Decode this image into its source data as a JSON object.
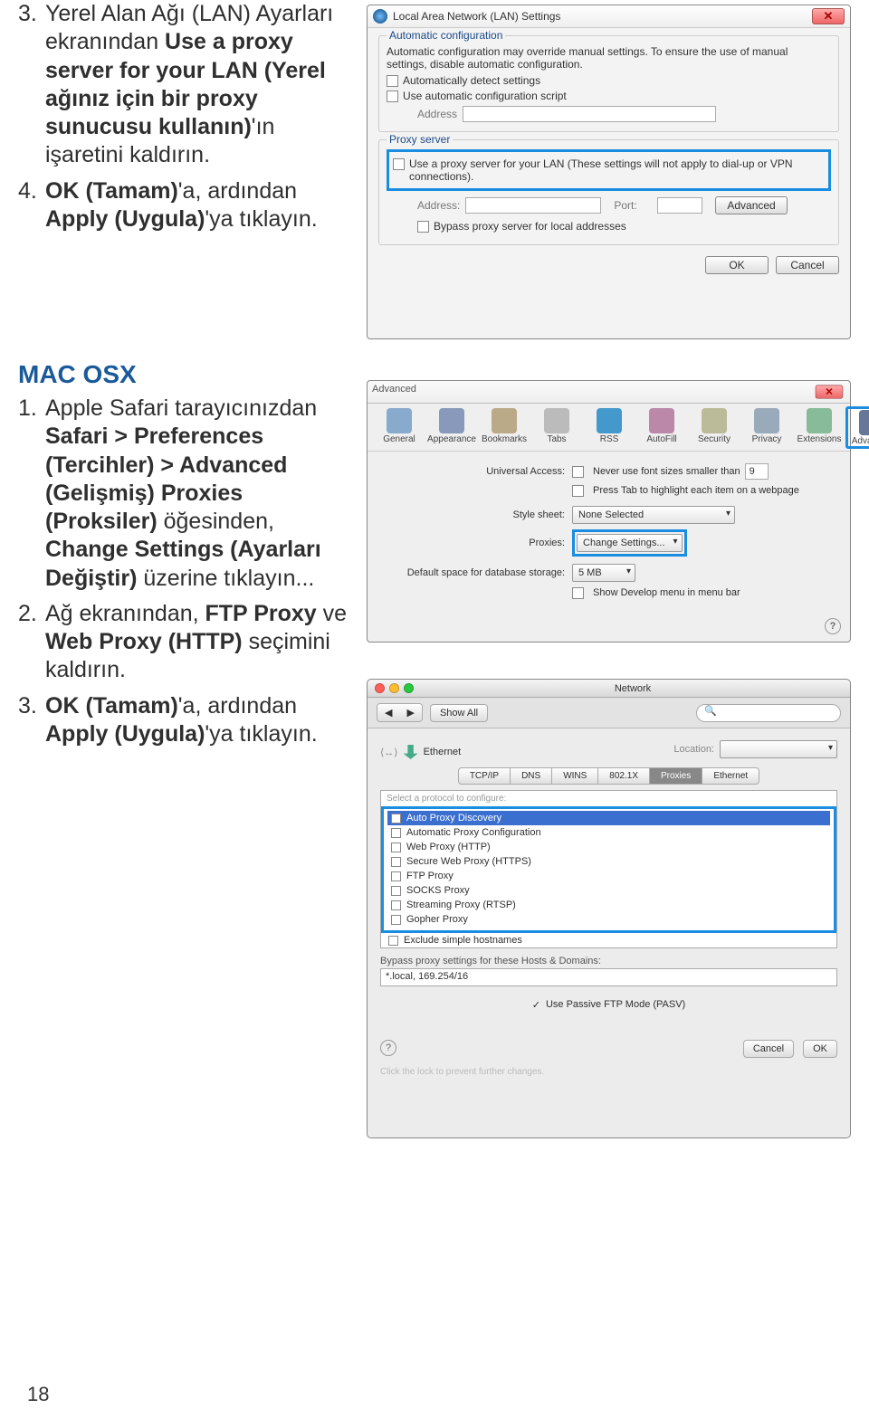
{
  "left": {
    "lan_steps": [
      {
        "num": "3.",
        "segments": [
          {
            "t": "Yerel Alan Ağı (LAN) Ayarları ekranından ",
            "b": false
          },
          {
            "t": "Use a proxy server for your LAN (Yerel ağınız için bir proxy sunucusu kullanın)",
            "b": true
          },
          {
            "t": "'ın işaretini kaldırın.",
            "b": false
          }
        ]
      },
      {
        "num": "4.",
        "segments": [
          {
            "t": "OK (Tamam)",
            "b": true
          },
          {
            "t": "'a, ardından ",
            "b": false
          },
          {
            "t": "Apply (Uygula)",
            "b": true
          },
          {
            "t": "'ya tıklayın.",
            "b": false
          }
        ]
      }
    ],
    "mac_heading": "MAC OSX",
    "mac_steps": [
      {
        "num": "1.",
        "segments": [
          {
            "t": "Apple Safari tarayıcınızdan ",
            "b": false
          },
          {
            "t": "Safari > Preferences (Tercihler) > Advanced (Gelişmiş) Proxies (Proksiler)",
            "b": true
          },
          {
            "t": " öğesinden, ",
            "b": false
          },
          {
            "t": "Change Settings (Ayarları Değiştir)",
            "b": true
          },
          {
            "t": " üzerine tıklayın...",
            "b": false
          }
        ]
      },
      {
        "num": "2.",
        "segments": [
          {
            "t": "Ağ ekranından, ",
            "b": false
          },
          {
            "t": "FTP Proxy",
            "b": true
          },
          {
            "t": " ve ",
            "b": false
          },
          {
            "t": "Web Proxy (HTTP)",
            "b": true
          },
          {
            "t": " seçimini kaldırın.",
            "b": false
          }
        ]
      },
      {
        "num": "3.",
        "segments": [
          {
            "t": "OK (Tamam)",
            "b": true
          },
          {
            "t": "'a, ardından ",
            "b": false
          },
          {
            "t": "Apply (Uygula)",
            "b": true
          },
          {
            "t": "'ya tıklayın.",
            "b": false
          }
        ]
      }
    ]
  },
  "lan": {
    "title": "Local Area Network (LAN) Settings",
    "legend_auto": "Automatic configuration",
    "auto_desc": "Automatic configuration may override manual settings. To ensure the use of manual settings, disable automatic configuration.",
    "auto_detect": "Automatically detect settings",
    "use_script": "Use automatic configuration script",
    "address_lbl": "Address",
    "legend_proxy": "Proxy server",
    "proxy_msg": "Use a proxy server for your LAN (These settings will not apply to dial-up or VPN connections).",
    "port_lbl": "Port:",
    "advanced_btn": "Advanced",
    "bypass": "Bypass proxy server for local addresses",
    "ok": "OK",
    "cancel": "Cancel"
  },
  "safari": {
    "title": "Advanced",
    "tabs": [
      "General",
      "Appearance",
      "Bookmarks",
      "Tabs",
      "RSS",
      "AutoFill",
      "Security",
      "Privacy",
      "Extensions",
      "Advanced"
    ],
    "ua_label": "Universal Access:",
    "ua_cb": "Never use font sizes smaller than",
    "ua_val": "9",
    "presstab": "Press Tab to highlight each item on a webpage",
    "stylesheet_lbl": "Style sheet:",
    "stylesheet_val": "None Selected",
    "proxies_lbl": "Proxies:",
    "change_btn": "Change Settings...",
    "db_lbl": "Default space for database storage:",
    "db_val": "5 MB",
    "develop_cb": "Show Develop menu in menu bar"
  },
  "network": {
    "title": "Network",
    "showall": "Show All",
    "location_lbl": "Location:",
    "eth": "Ethernet",
    "tabs": [
      "TCP/IP",
      "DNS",
      "WINS",
      "802.1X",
      "Proxies",
      "Ethernet"
    ],
    "select_proto": "Select a protocol to configure:",
    "protocols": [
      {
        "label": "Auto Proxy Discovery",
        "sel": true
      },
      {
        "label": "Automatic Proxy Configuration",
        "sel": false
      },
      {
        "label": "Web Proxy (HTTP)",
        "sel": false
      },
      {
        "label": "Secure Web Proxy (HTTPS)",
        "sel": false
      },
      {
        "label": "FTP Proxy",
        "sel": false
      },
      {
        "label": "SOCKS Proxy",
        "sel": false
      },
      {
        "label": "Streaming Proxy (RTSP)",
        "sel": false
      },
      {
        "label": "Gopher Proxy",
        "sel": false
      }
    ],
    "exclude": "Exclude simple hostnames",
    "bypass_lbl": "Bypass proxy settings for these Hosts & Domains:",
    "bypass_val": "*.local, 169.254/16",
    "pasv": "Use Passive FTP Mode (PASV)",
    "cancel": "Cancel",
    "ok": "OK",
    "lock_note": "Click the lock to prevent further changes."
  },
  "page_num": "18"
}
